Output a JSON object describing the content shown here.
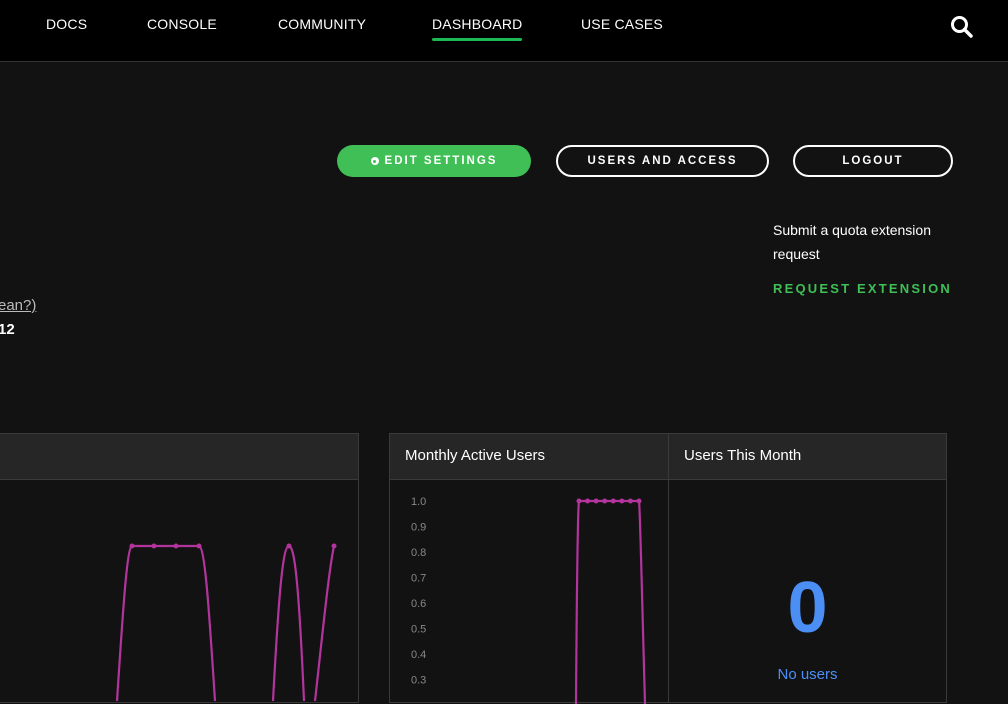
{
  "nav": {
    "links": [
      "DOCS",
      "CONSOLE",
      "COMMUNITY",
      "DASHBOARD",
      "USE CASES"
    ],
    "active": "DASHBOARD",
    "search_icon": "search-icon"
  },
  "actions": {
    "edit_settings": "EDIT SETTINGS",
    "users_and_access": "USERS AND ACCESS",
    "logout": "LOGOUT"
  },
  "quota": {
    "text": "Submit a quota extension request",
    "link": "REQUEST EXTENSION"
  },
  "left_partial": {
    "link_text": "ean?)",
    "number_text": "12"
  },
  "panels": {
    "monthly_active_users": "Monthly Active Users",
    "users_this_month": "Users This Month",
    "users_count": "0",
    "users_caption": "No users"
  },
  "colors": {
    "accent": "#3fbf55",
    "series": "#b2349c",
    "stat": "#4b8ff5"
  },
  "chart_data": [
    {
      "type": "line",
      "title": "",
      "series": [
        {
          "values_visible": "partial; plateau at 1.0 with drops to 0"
        }
      ]
    },
    {
      "type": "line",
      "title": "Monthly Active Users",
      "yticks": [
        "1.0",
        "0.9",
        "0.8",
        "0.7",
        "0.6",
        "0.5",
        "0.4",
        "0.3"
      ],
      "ylim": [
        0.3,
        1.0
      ],
      "series": [
        {
          "values": [
            0,
            1.0,
            1.0,
            1.0,
            1.0,
            1.0,
            1.0,
            1.0,
            1.0,
            0
          ]
        }
      ]
    }
  ]
}
